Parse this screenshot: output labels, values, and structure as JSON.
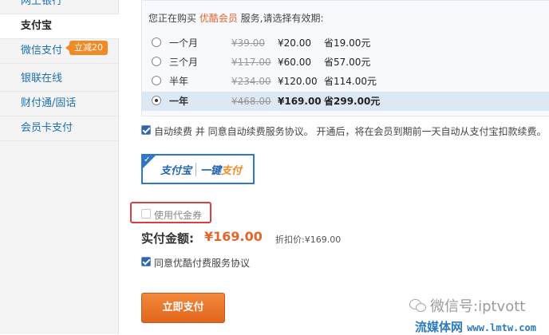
{
  "sidebar": {
    "items": [
      {
        "label": "网上银行"
      },
      {
        "label": "支付宝"
      },
      {
        "label": "微信支付"
      },
      {
        "label": "银联在线"
      },
      {
        "label": "财付通/固话"
      },
      {
        "label": "会员卡支付"
      }
    ],
    "badge": "立减20"
  },
  "purchase": {
    "intro_prefix": "您正在购买 ",
    "product": "优酷会员",
    "intro_suffix": " 服务,请选择有效期:",
    "plans": [
      {
        "name": "一个月",
        "original": "¥39.00",
        "price": "¥20.00",
        "save": "省19.00元",
        "selected": false
      },
      {
        "name": "三个月",
        "original": "¥117.00",
        "price": "¥60.00",
        "save": "省57.00元",
        "selected": false
      },
      {
        "name": "半年",
        "original": "¥234.00",
        "price": "¥120.00",
        "save": "省114.00元",
        "selected": false
      },
      {
        "name": "一年",
        "original": "¥468.00",
        "price": "¥169.00",
        "save": "省299.00元",
        "selected": true
      }
    ]
  },
  "auto_renew": {
    "label": "自动续费 并 同意自动续费服务协议。 开通后，将在会员到期前一天自动从支付宝扣款续费。",
    "checked": true
  },
  "alipay_logo": {
    "brand": "支付宝",
    "key_prefix": "一键",
    "key_suffix": "支付"
  },
  "coupon": {
    "label": "使用代金券",
    "checked": false
  },
  "total": {
    "label": "实付金额:",
    "amount": "¥169.00",
    "discount": "折扣价:¥169.00"
  },
  "agreement": {
    "label": "同意优酷付费服务协议",
    "checked": true
  },
  "pay_button": "立即支付",
  "wechat_watermark": "微信号:iptvott",
  "site_watermark": {
    "name": "流媒体网",
    "url": "www.lmtw.com"
  }
}
